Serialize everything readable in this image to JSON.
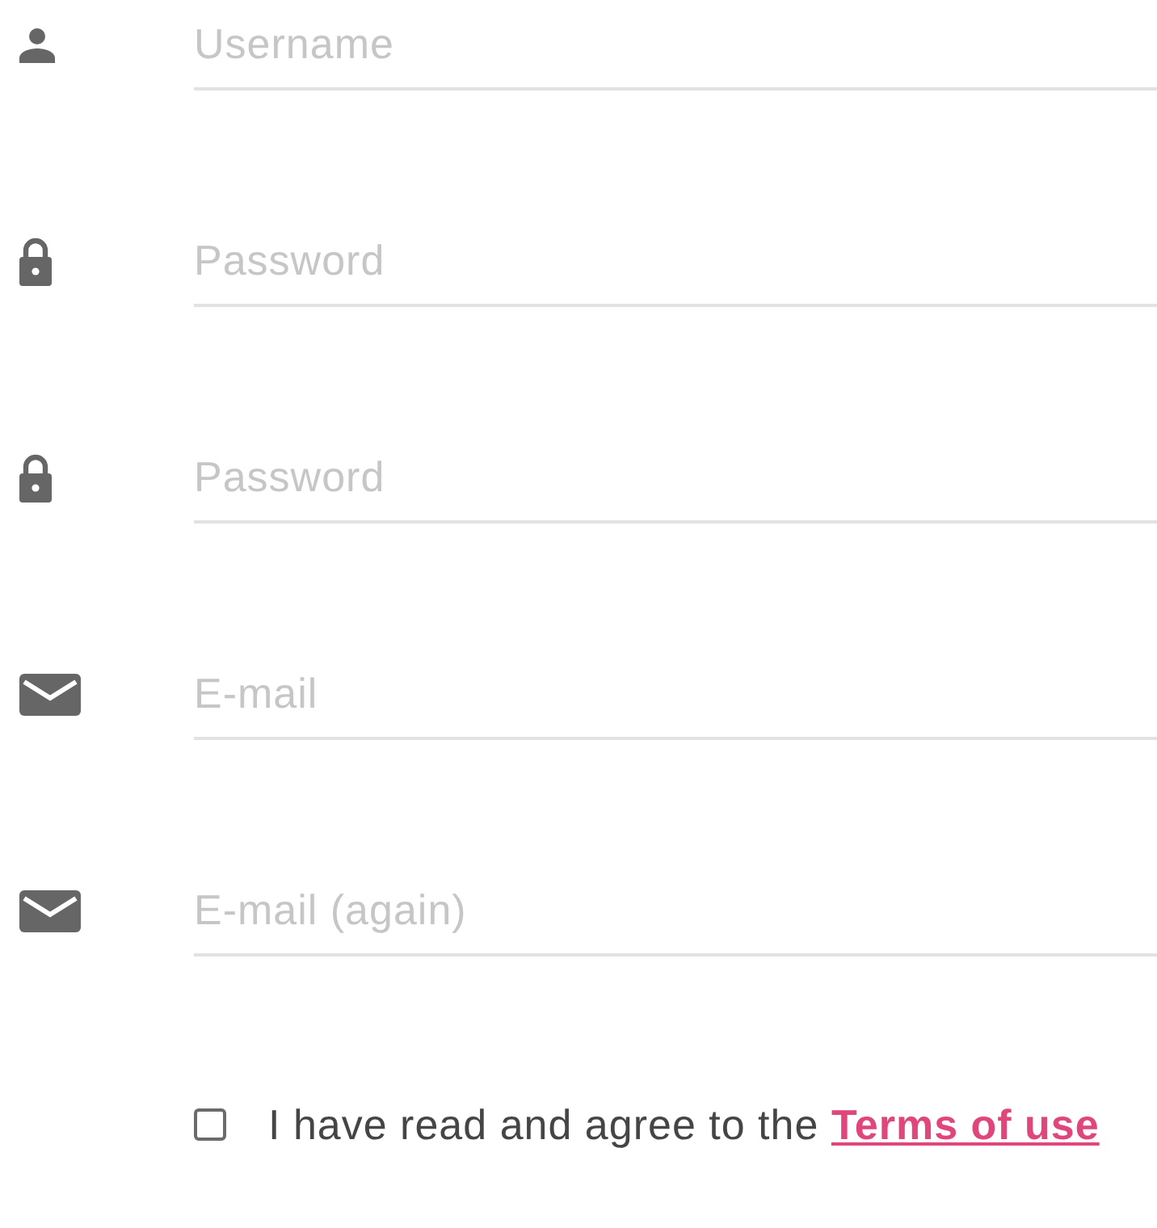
{
  "fields": [
    {
      "kind": "person",
      "placeholder": "Username"
    },
    {
      "kind": "lock",
      "placeholder": "Password"
    },
    {
      "kind": "lock",
      "placeholder": "Password"
    },
    {
      "kind": "mail",
      "placeholder": "E-mail"
    },
    {
      "kind": "mail",
      "placeholder": "E-mail (again)"
    }
  ],
  "agreement": {
    "checked": false,
    "text": "I have read and agree to the",
    "link": "Terms of use"
  }
}
